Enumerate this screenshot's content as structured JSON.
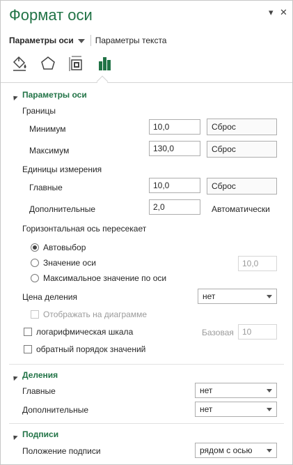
{
  "pane": {
    "title": "Формат оси",
    "controls": {
      "menu_glyph": "▾",
      "close_glyph": "✕"
    },
    "tabs": {
      "axis_options": "Параметры оси",
      "text_options": "Параметры текста"
    },
    "icons": [
      "fill-line-icon",
      "effects-pentagon-icon",
      "size-properties-icon",
      "axis-options-bar-chart-icon"
    ],
    "accent_color": "#217346"
  },
  "axis_options": {
    "header": "Параметры оси",
    "bounds": {
      "label": "Границы",
      "minimum": {
        "label": "Минимум",
        "value": "10,0",
        "button": "Сброс"
      },
      "maximum": {
        "label": "Максимум",
        "value": "130,0",
        "button": "Сброс"
      }
    },
    "units": {
      "label": "Единицы измерения",
      "major": {
        "label": "Главные",
        "value": "10,0",
        "button": "Сброс"
      },
      "minor": {
        "label": "Дополнительные",
        "value": "2,0",
        "state": "Автоматически"
      }
    },
    "crosses": {
      "label": "Горизонтальная ось пересекает",
      "options": [
        {
          "label": "Автовыбор",
          "selected": true
        },
        {
          "label": "Значение оси",
          "selected": false,
          "value": "10,0"
        },
        {
          "label": "Максимальное значение по оси",
          "selected": false
        }
      ]
    },
    "display_units": {
      "label": "Цена деления",
      "value": "нет",
      "show_on_chart": "Отображать на диаграмме"
    },
    "log_scale": {
      "label": "логарифмическая шкала",
      "base_label": "Базовая",
      "base_value": "10"
    },
    "reverse_order": {
      "label": "обратный порядок значений"
    }
  },
  "tick_marks": {
    "header": "Деления",
    "major": {
      "label": "Главные",
      "value": "нет"
    },
    "minor": {
      "label": "Дополнительные",
      "value": "нет"
    }
  },
  "labels": {
    "header": "Подписи",
    "position": {
      "label": "Положение подписи",
      "value": "рядом с осью"
    }
  }
}
